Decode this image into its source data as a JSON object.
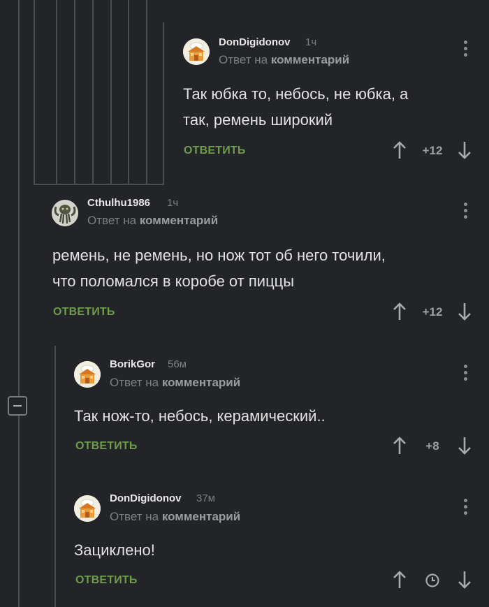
{
  "comments": [
    {
      "author": "DonDigidonov",
      "time": "1ч",
      "reply_prefix": "Ответ на",
      "reply_link": "комментарий",
      "lines": [
        "Так юбка то, небось, не юбка, а",
        "так, ремень широкий"
      ],
      "reply_label": "ОТВЕТИТЬ",
      "score": "+12",
      "avatar_icon": "bakery-house-icon"
    },
    {
      "author": "Cthulhu1986",
      "time": "1ч",
      "reply_prefix": "Ответ на",
      "reply_link": "комментарий",
      "lines": [
        "ремень, не ремень, но нож тот об него точили,",
        "что поломался в коробе от пиццы"
      ],
      "reply_label": "ОТВЕТИТЬ",
      "score": "+12",
      "avatar_icon": "cthulhu-avatar-icon"
    },
    {
      "author": "BorikGor",
      "time": "56м",
      "reply_prefix": "Ответ на",
      "reply_link": "комментарий",
      "lines": [
        "Так нож-то, небось, керамический.."
      ],
      "reply_label": "ОТВЕТИТЬ",
      "score": "+8",
      "avatar_icon": "bakery-house-icon"
    },
    {
      "author": "DonDigidonov",
      "time": "37м",
      "reply_prefix": "Ответ на",
      "reply_link": "комментарий",
      "lines": [
        "Зациклено!"
      ],
      "reply_label": "ОТВЕТИТЬ",
      "score_icon": "clock-icon",
      "avatar_icon": "bakery-house-icon"
    }
  ],
  "colors": {
    "background": "#232427",
    "reply_green": "#6e9b4d",
    "muted": "#7d7f84",
    "thread_line": "#4a4c50"
  }
}
